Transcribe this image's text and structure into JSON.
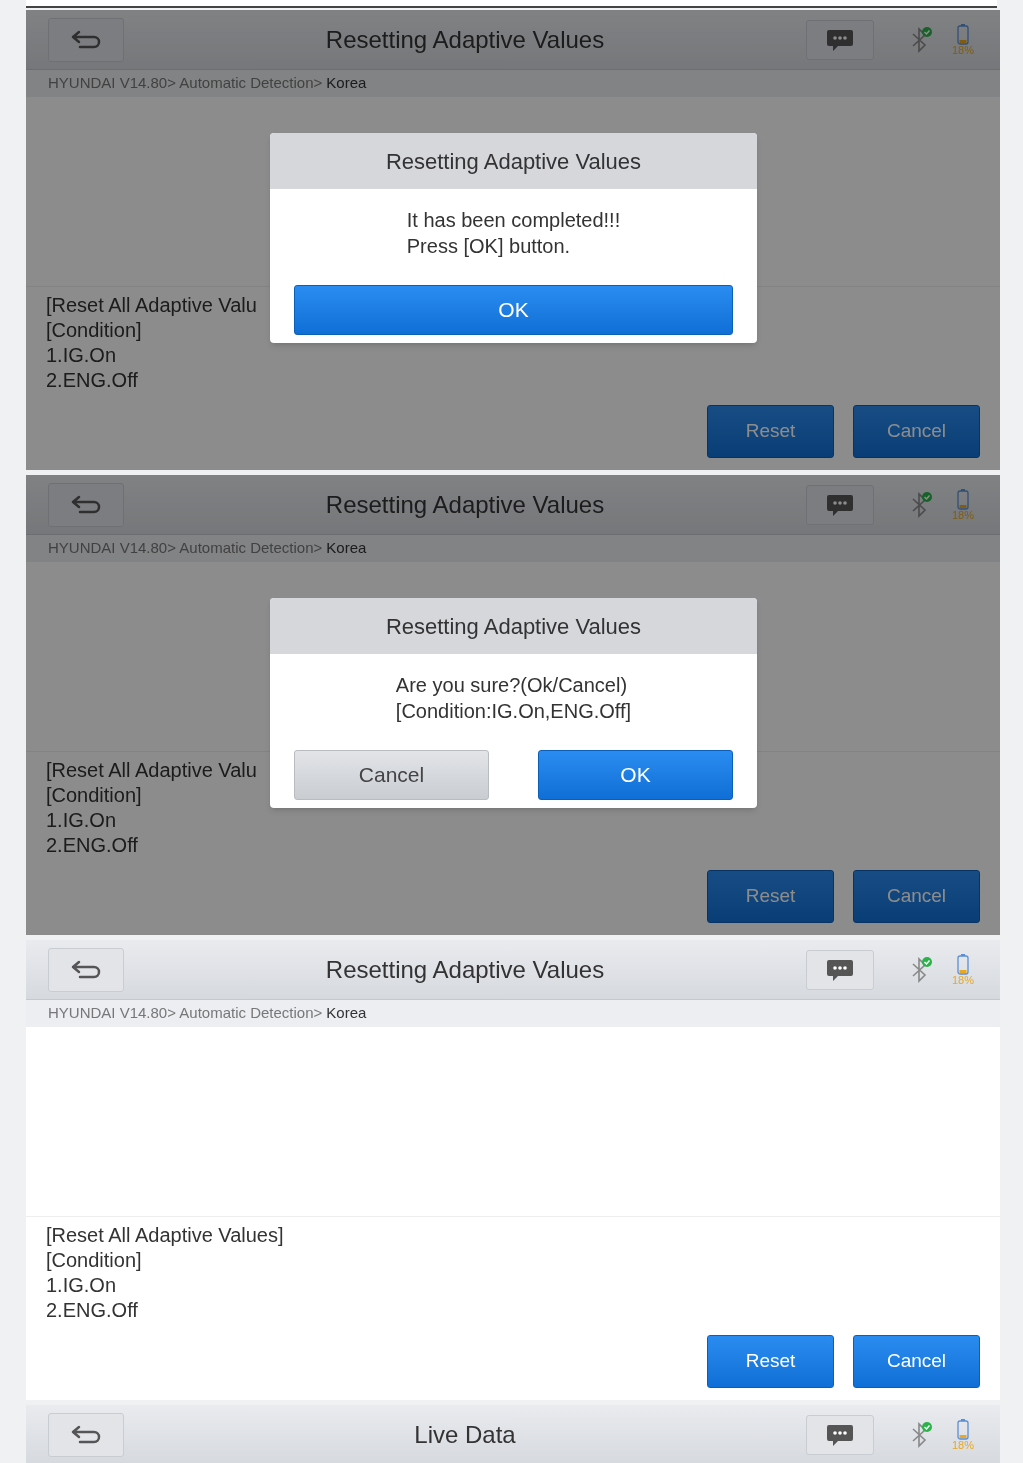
{
  "screens": [
    {
      "header": {
        "title": "Resetting Adaptive Values",
        "battery": "18%"
      },
      "breadcrumb": {
        "path": "HYUNDAI V14.80> Automatic Detection>",
        "current": "Korea"
      },
      "instructions": [
        "[Reset All Adaptive Valu",
        "[Condition]",
        "1.IG.On",
        "2.ENG.Off"
      ],
      "buttons": [
        "Reset",
        "Cancel"
      ],
      "dialog": {
        "title": "Resetting Adaptive Values",
        "message": [
          "It has been completed!!!",
          "Press [OK] button."
        ],
        "buttons": [
          {
            "label": "OK",
            "kind": "primary"
          }
        ]
      }
    },
    {
      "header": {
        "title": "Resetting Adaptive Values",
        "battery": "18%"
      },
      "breadcrumb": {
        "path": "HYUNDAI V14.80> Automatic Detection>",
        "current": "Korea"
      },
      "instructions": [
        "[Reset All Adaptive Valu",
        "[Condition]",
        "1.IG.On",
        "2.ENG.Off"
      ],
      "buttons": [
        "Reset",
        "Cancel"
      ],
      "dialog": {
        "title": "Resetting Adaptive Values",
        "message": [
          "Are you sure?(Ok/Cancel)",
          "[Condition:IG.On,ENG.Off]"
        ],
        "buttons": [
          {
            "label": "Cancel",
            "kind": "secondary"
          },
          {
            "label": "OK",
            "kind": "primary"
          }
        ]
      }
    },
    {
      "header": {
        "title": "Resetting Adaptive Values",
        "battery": "18%"
      },
      "breadcrumb": {
        "path": "HYUNDAI V14.80> Automatic Detection>",
        "current": "Korea"
      },
      "instructions": [
        "[Reset All Adaptive Values]",
        "[Condition]",
        "1.IG.On",
        "2.ENG.Off"
      ],
      "buttons": [
        "Reset",
        "Cancel"
      ]
    }
  ],
  "next_screen": {
    "title": "Live Data",
    "battery": "18%"
  }
}
